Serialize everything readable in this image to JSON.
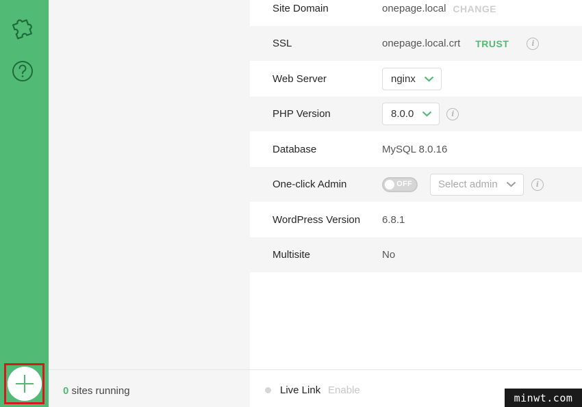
{
  "rail": {
    "addons_icon": "puzzle-icon",
    "help_icon": "question-circle-icon",
    "add_icon": "plus-icon",
    "accent": "#51bb75"
  },
  "details": {
    "site_domain": {
      "label": "Site Domain",
      "value": "onepage.local",
      "action": "CHANGE"
    },
    "ssl": {
      "label": "SSL",
      "value": "onepage.local.crt",
      "action": "TRUST"
    },
    "web_server": {
      "label": "Web Server",
      "value": "nginx"
    },
    "php_version": {
      "label": "PHP Version",
      "value": "8.0.0"
    },
    "database": {
      "label": "Database",
      "value": "MySQL 8.0.16"
    },
    "one_click_admin": {
      "label": "One-click Admin",
      "toggle": "OFF",
      "placeholder": "Select admin"
    },
    "wordpress_version": {
      "label": "WordPress Version",
      "value": "6.8.1"
    },
    "multisite": {
      "label": "Multisite",
      "value": "No"
    }
  },
  "footer": {
    "running_count": "0",
    "running_label": "sites running",
    "live_link_label": "Live Link",
    "live_link_action": "Enable"
  },
  "watermark": "minwt.com"
}
